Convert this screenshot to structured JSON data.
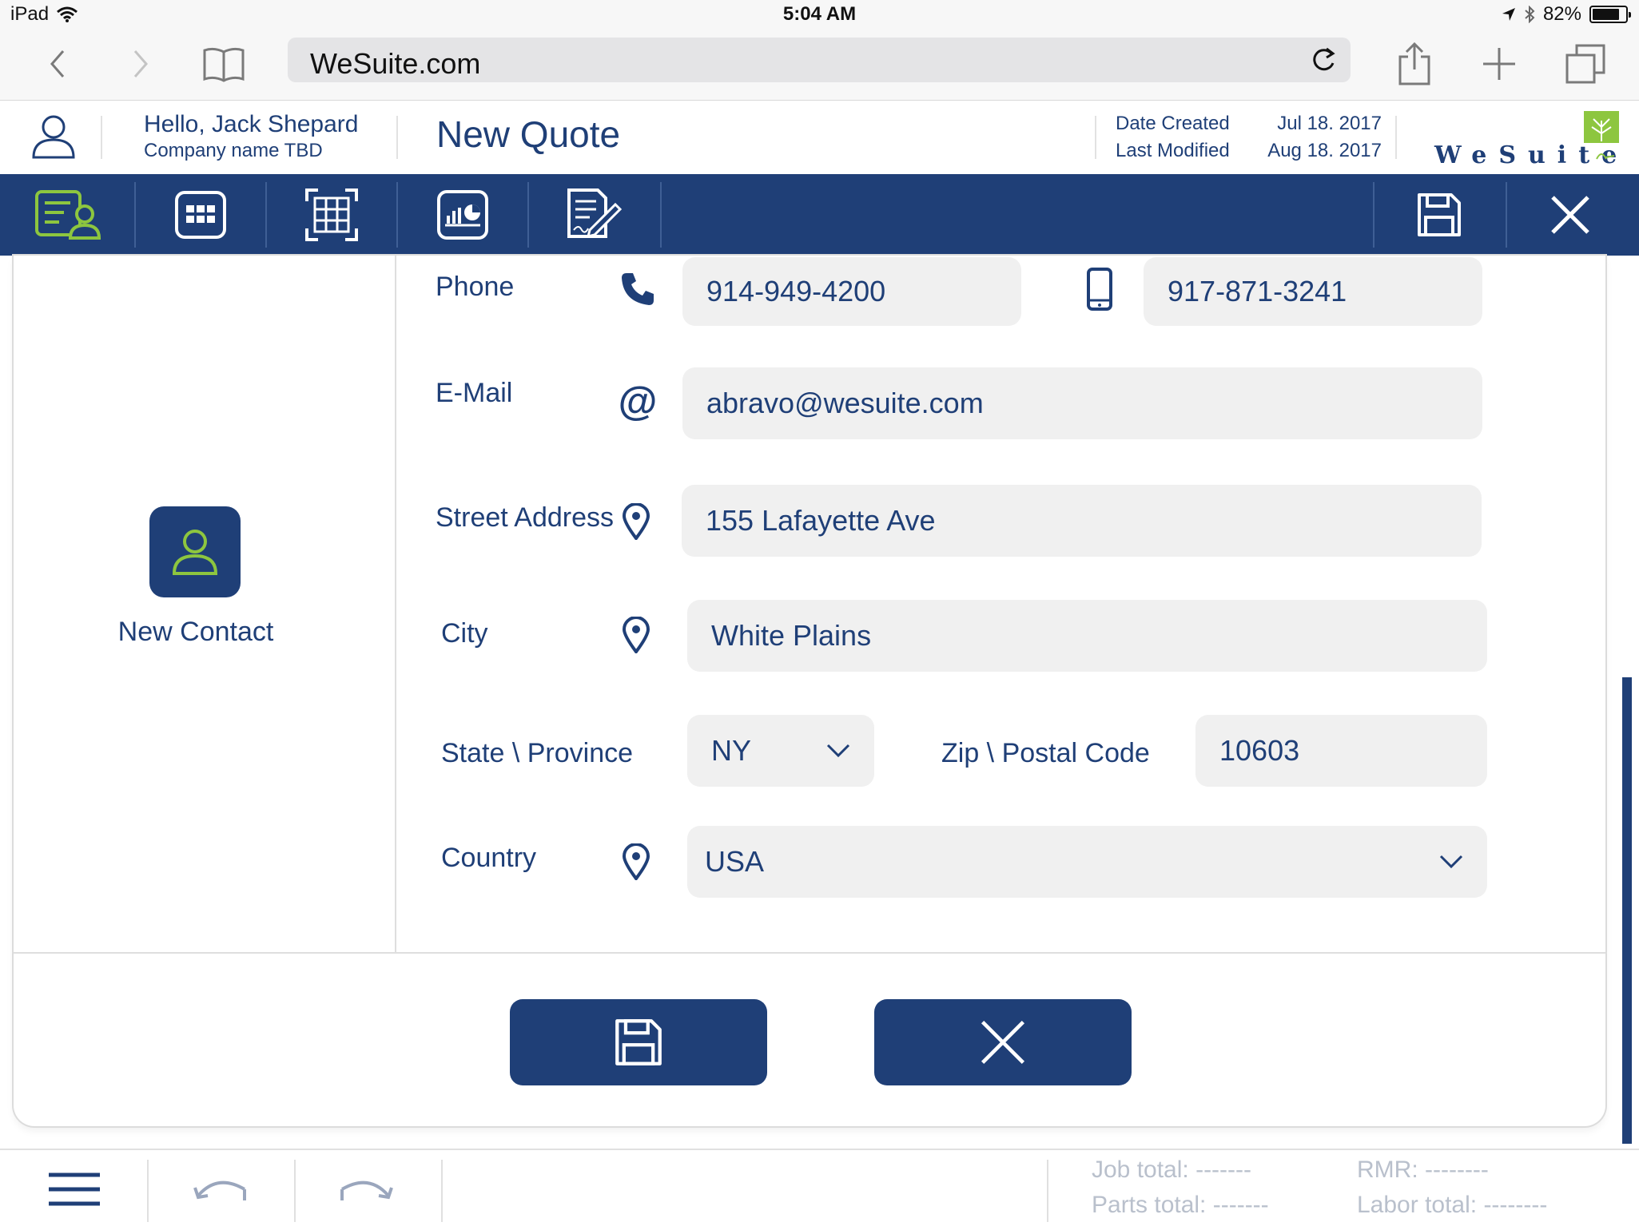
{
  "status_bar": {
    "device": "iPad",
    "time": "5:04 AM",
    "battery": "82%",
    "battery_level": 0.82
  },
  "browser": {
    "url": "WeSuite.com"
  },
  "header": {
    "greeting": "Hello, Jack Shepard",
    "company": "Company name TBD",
    "title": "New Quote",
    "date_created_label": "Date Created",
    "date_created": "Jul 18. 2017",
    "last_modified_label": "Last Modified",
    "last_modified": "Aug 18. 2017",
    "logo_text": "WeSuite"
  },
  "toolbar": {
    "items": [
      {
        "icon": "customer-info-icon",
        "active": true
      },
      {
        "icon": "keypad-icon"
      },
      {
        "icon": "grid-scan-icon"
      },
      {
        "icon": "report-chart-icon"
      },
      {
        "icon": "sign-document-icon"
      }
    ],
    "save_icon": "save-icon",
    "close_icon": "close-icon"
  },
  "left_panel": {
    "new_contact_label": "New Contact"
  },
  "form": {
    "phone_label": "Phone",
    "phone_value": "914-949-4200",
    "mobile_value": "917-871-3241",
    "email_label": "E-Mail",
    "email_value": "abravo@wesuite.com",
    "street_label": "Street Address",
    "street_value": "155 Lafayette Ave",
    "city_label": "City",
    "city_value": "White Plains",
    "state_label": "State \\ Province",
    "state_value": "NY",
    "zip_label": "Zip \\ Postal Code",
    "zip_value": "10603",
    "country_label": "Country",
    "country_value": "USA"
  },
  "footer": {
    "job_total": "Job total: -------",
    "parts_total": "Parts total: -------",
    "rmr": "RMR: --------",
    "labor_total": "Labor total: --------"
  },
  "colors": {
    "primary": "#1f3f77",
    "accent_green": "#8dc63f",
    "field_bg": "#f0f0f0",
    "muted_text": "#b9c0cc"
  }
}
